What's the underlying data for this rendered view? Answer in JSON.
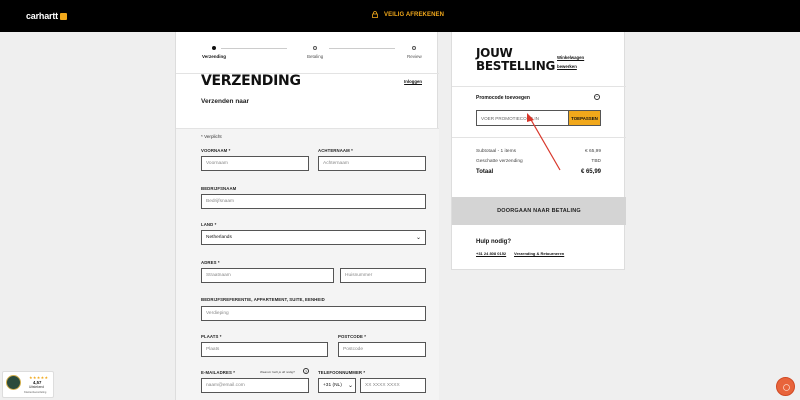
{
  "header": {
    "logo": "carhartt",
    "secure_text": "VEILIG AFREKENEN",
    "lock_icon": "lock-icon"
  },
  "steps": [
    {
      "label": "Verzending",
      "active": true
    },
    {
      "label": "Betaling",
      "active": false
    },
    {
      "label": "Review",
      "active": false
    }
  ],
  "shipping": {
    "title": "VERZENDING",
    "subtitle": "Verzenden naar",
    "login_link": "Inloggen",
    "required_note": "* Verplicht",
    "first_name_label": "VOORNAAM *",
    "first_name_placeholder": "Voornaam",
    "last_name_label": "ACHTERNAAM *",
    "last_name_placeholder": "Achternaam",
    "company_label": "BEDRIJFSNAAM",
    "company_placeholder": "Bedrijfsnaam",
    "country_label": "LAND *",
    "country_value": "Netherlands",
    "address_label": "ADRES *",
    "street_placeholder": "Straatnaam",
    "house_number_placeholder": "Huisnummer",
    "extra_label": "BEDRIJFSREFERENTIE, APPARTEMENT, SUITE, EENHEID",
    "extra_placeholder": "Verdieping",
    "city_label": "PLAATS *",
    "city_placeholder": "Plaats",
    "postcode_label": "POSTCODE *",
    "postcode_placeholder": "Postcode",
    "email_label": "E-MAILADRES *",
    "email_help": "Waarom hebt je dit nodig?",
    "email_placeholder": "naam@email.com",
    "phone_label": "TELEFOONNUMMER *",
    "phone_prefix": "+31 (NL)",
    "phone_placeholder": "XX XXXX XXXX"
  },
  "order": {
    "title_line1": "JOUW",
    "title_line2": "BESTELLING",
    "edit_cart_line1": "Winkelwagen",
    "edit_cart_line2": "bewerken",
    "promo_label": "Promocode toevoegen",
    "promo_placeholder": "VOER PROMOTIECODE IN",
    "promo_button": "TOEPASSEN",
    "subtotal_label": "Subtotaal - 1 items",
    "subtotal_value": "€ 65,99",
    "shipping_label": "Geschatte verzending",
    "shipping_value": "TBD",
    "total_label": "Totaal",
    "total_value": "€ 65,99",
    "checkout_button": "DOORGAAN NAAR BETALING",
    "help_title": "Hulp nodig?",
    "help_phone": "+31 24 808 0152",
    "help_shipping": "Verzending & Retourneren"
  },
  "trust_badge": {
    "stars": "★★★★★",
    "score": "4,57",
    "label": "Uitstekend",
    "sub": "Klantenbeoordeling"
  },
  "colors": {
    "accent": "#f1a81b",
    "annotation_arrow": "#d8372b",
    "chat": "#e8643b"
  }
}
